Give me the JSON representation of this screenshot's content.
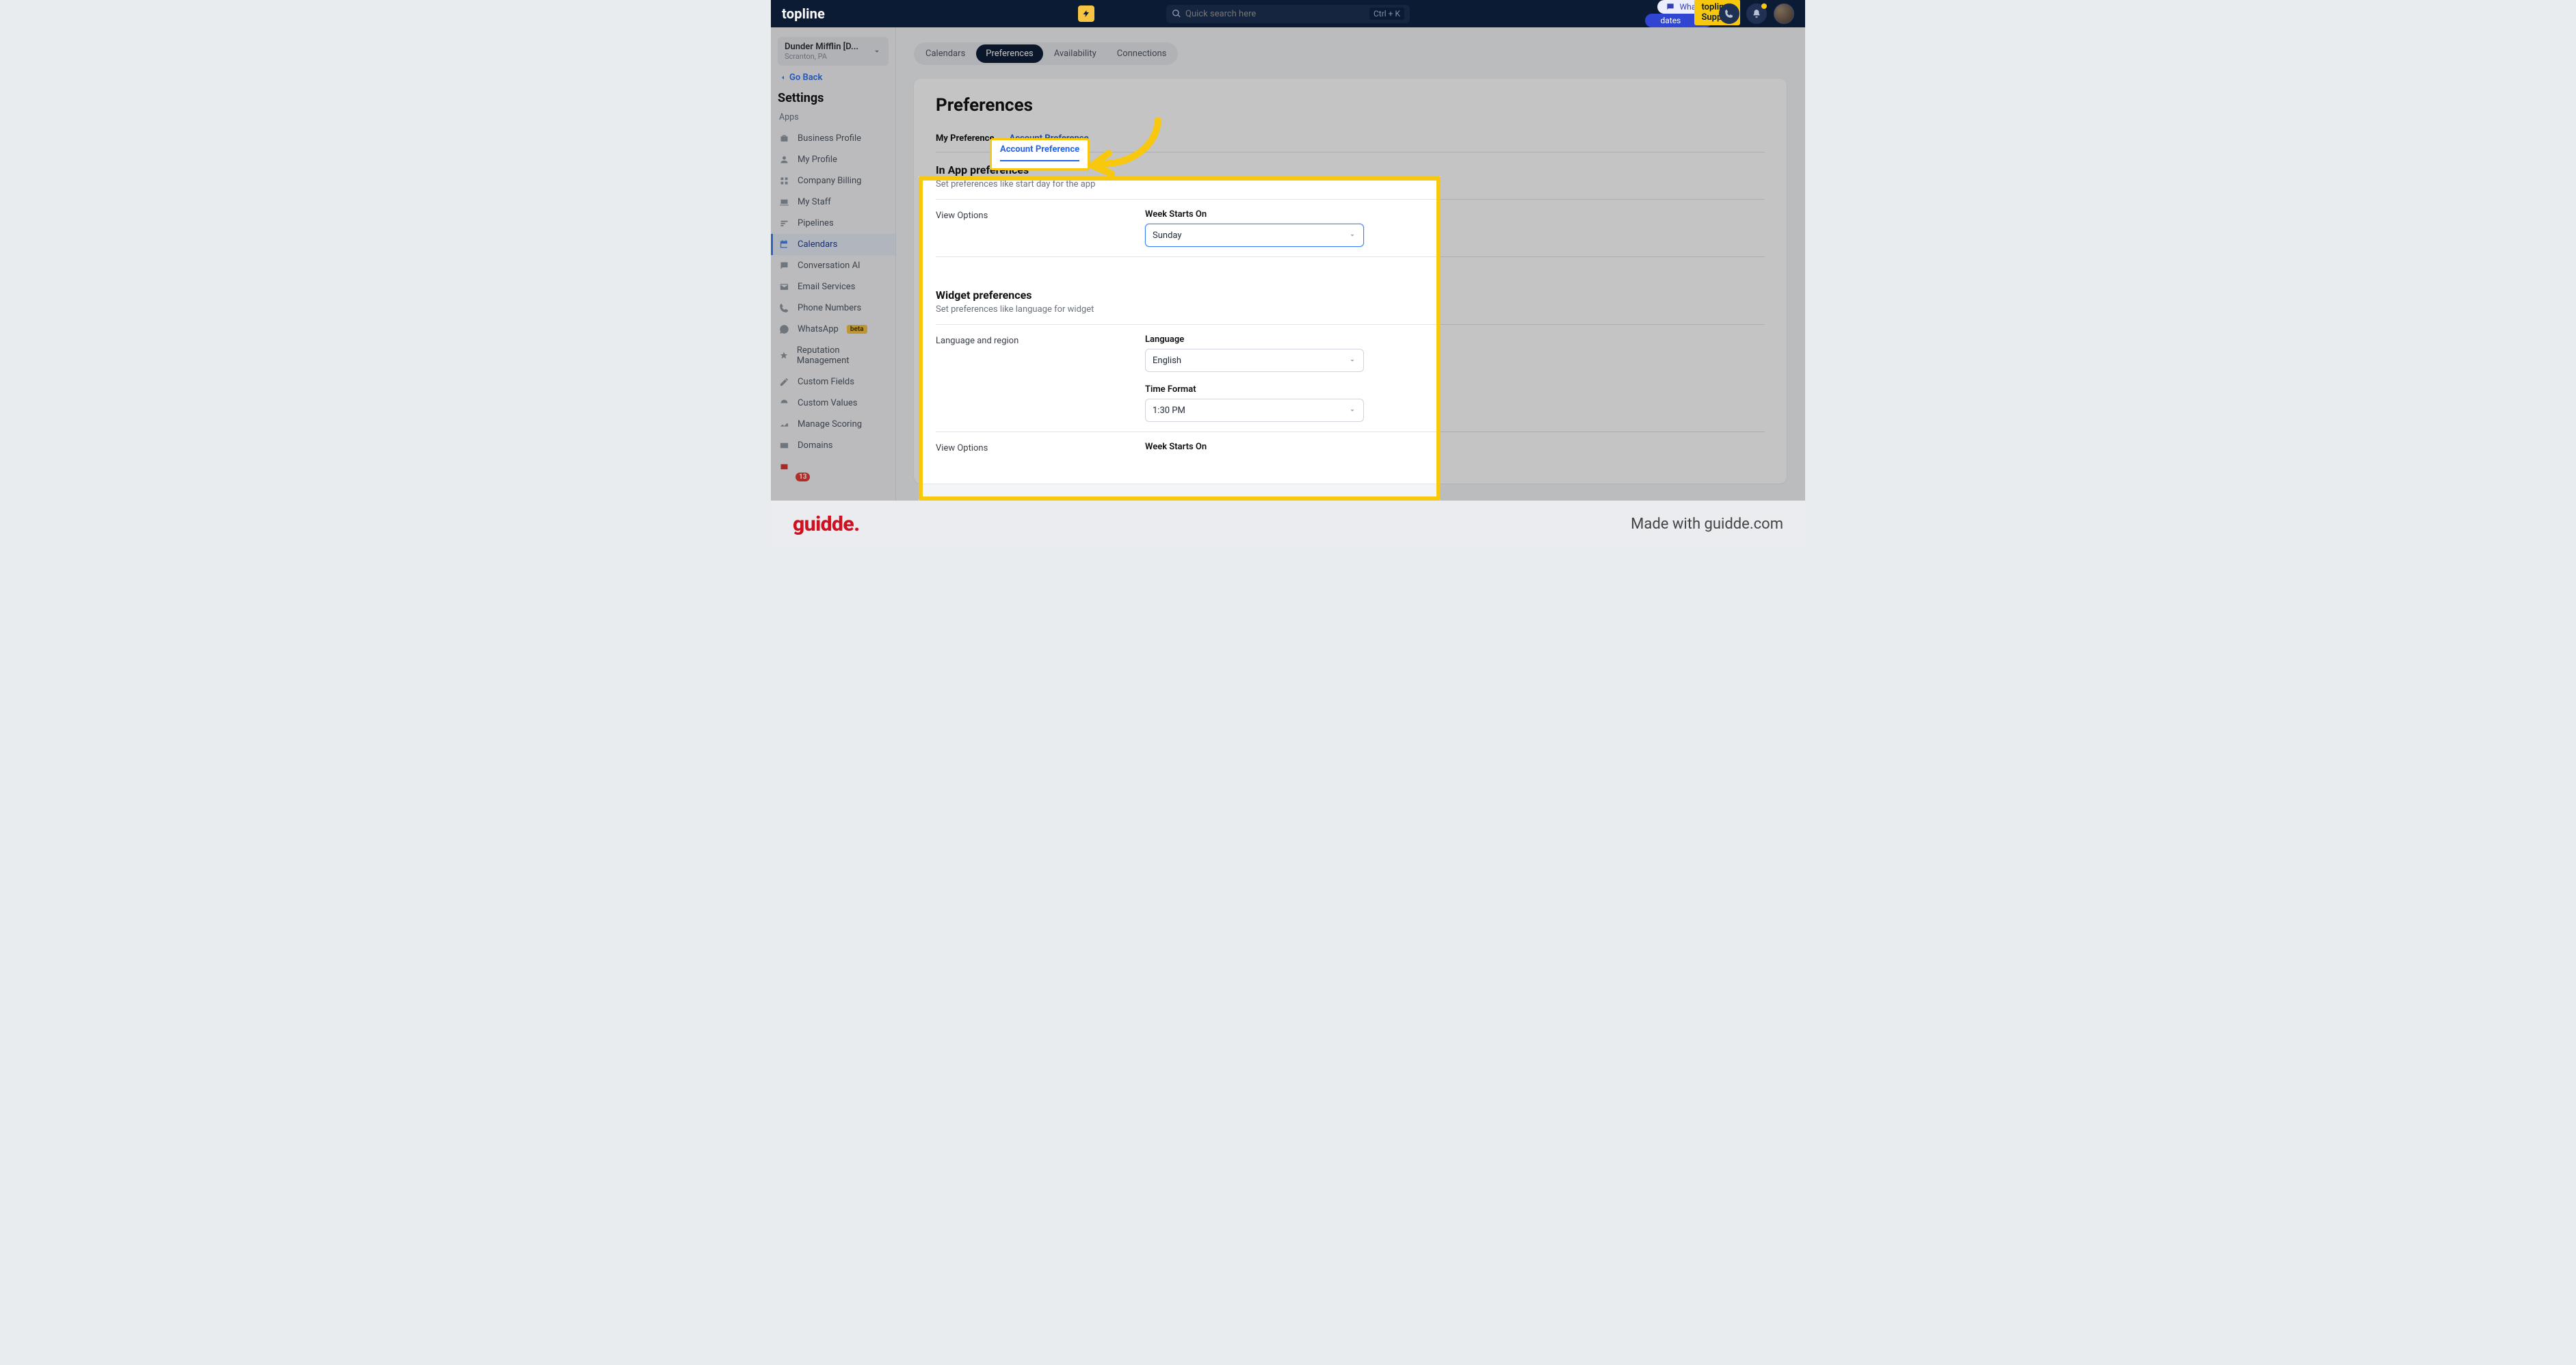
{
  "header": {
    "logo": "topline",
    "search_placeholder": "Quick search here",
    "search_hint": "Ctrl + K",
    "whats_new": "What's",
    "updates": "dates",
    "support_badge": "topline Support"
  },
  "account": {
    "name": "Dunder Mifflin [D...",
    "location": "Scranton, PA"
  },
  "sidebar": {
    "go_back": "Go Back",
    "section_title": "Settings",
    "section_group": "Apps",
    "items": [
      {
        "label": "Business Profile",
        "icon": "briefcase"
      },
      {
        "label": "My Profile",
        "icon": "person"
      },
      {
        "label": "Company Billing",
        "icon": "grid"
      },
      {
        "label": "My Staff",
        "icon": "laptop"
      },
      {
        "label": "Pipelines",
        "icon": "pipe"
      },
      {
        "label": "Calendars",
        "icon": "calendar"
      },
      {
        "label": "Conversation AI",
        "icon": "chat"
      },
      {
        "label": "Email Services",
        "icon": "envelope"
      },
      {
        "label": "Phone Numbers",
        "icon": "phone"
      },
      {
        "label": "WhatsApp",
        "icon": "whatsapp",
        "badge": "beta"
      },
      {
        "label": "Reputation Management",
        "icon": "star"
      },
      {
        "label": "Custom Fields",
        "icon": "edit"
      },
      {
        "label": "Custom Values",
        "icon": "gauge"
      },
      {
        "label": "Manage Scoring",
        "icon": "trend"
      },
      {
        "label": "Domains",
        "icon": "card"
      }
    ],
    "notif_count": "13"
  },
  "tabs": [
    {
      "label": "Calendars"
    },
    {
      "label": "Preferences"
    },
    {
      "label": "Availability"
    },
    {
      "label": "Connections"
    }
  ],
  "page": {
    "title": "Preferences",
    "sub_tabs": [
      {
        "label": "My Preference"
      },
      {
        "label": "Account Preference"
      }
    ],
    "blocks": [
      {
        "heading": "In App preferences",
        "desc": "Set preferences like start day for the app",
        "rows": [
          {
            "row_label": "View Options",
            "fields": [
              {
                "label": "Week Starts On",
                "value": "Sunday",
                "focus": true
              }
            ]
          }
        ]
      },
      {
        "heading": "Widget preferences",
        "desc": "Set preferences like language for widget",
        "rows": [
          {
            "row_label": "Language and region",
            "fields": [
              {
                "label": "Language",
                "value": "English"
              },
              {
                "label": "Time Format",
                "value": "1:30 PM"
              }
            ]
          },
          {
            "row_label": "View Options",
            "fields": [
              {
                "label": "Week Starts On",
                "value": ""
              }
            ]
          }
        ]
      }
    ]
  },
  "footer": {
    "logo": "guidde.",
    "made": "Made with guidde.com"
  }
}
